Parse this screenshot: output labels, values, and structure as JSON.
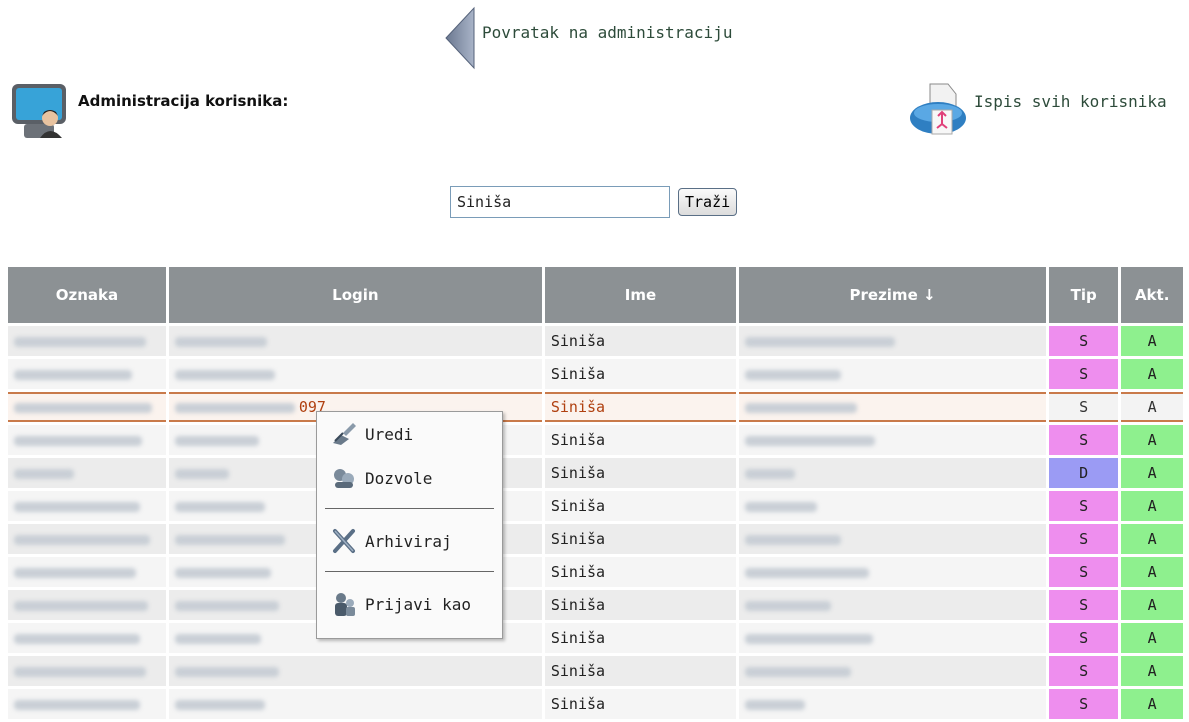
{
  "nav": {
    "back_label": "Povratak na administraciju",
    "page_title": "Administracija korisnika:",
    "print_label": "Ispis svih korisnika"
  },
  "search": {
    "value": "Siniša",
    "button_label": "Traži"
  },
  "table": {
    "headers": {
      "oznaka": "Oznaka",
      "login": "Login",
      "ime": "Ime",
      "prezime": "Prezime ↓",
      "tip": "Tip",
      "akt": "Akt."
    },
    "rows": [
      {
        "login_suffix": "",
        "ime": "Siniša",
        "tip": "S",
        "akt": "A"
      },
      {
        "login_suffix": "",
        "ime": "Siniša",
        "tip": "S",
        "akt": "A"
      },
      {
        "login_suffix": "097",
        "ime": "Siniša",
        "tip": "S",
        "akt": "A"
      },
      {
        "login_suffix": "",
        "ime": "Siniša",
        "tip": "S",
        "akt": "A"
      },
      {
        "login_suffix": "",
        "ime": "Siniša",
        "tip": "D",
        "akt": "A"
      },
      {
        "login_suffix": "",
        "ime": "Siniša",
        "tip": "S",
        "akt": "A"
      },
      {
        "login_suffix": "",
        "ime": "Siniša",
        "tip": "S",
        "akt": "A"
      },
      {
        "login_suffix": "",
        "ime": "Siniša",
        "tip": "S",
        "akt": "A"
      },
      {
        "login_suffix": "",
        "ime": "Siniša",
        "tip": "S",
        "akt": "A"
      },
      {
        "login_suffix": "",
        "ime": "Siniša",
        "tip": "S",
        "akt": "A"
      },
      {
        "login_suffix": "",
        "ime": "Siniša",
        "tip": "S",
        "akt": "A"
      },
      {
        "login_suffix": "",
        "ime": "Siniša",
        "tip": "S",
        "akt": "A"
      }
    ]
  },
  "context_menu": {
    "edit": "Uredi",
    "permissions": "Dozvole",
    "archive": "Arhiviraj",
    "login_as": "Prijavi kao"
  },
  "colors": {
    "header_bg": "#8c9194",
    "tip_s": "#ee8eee",
    "tip_d": "#9b9bf4",
    "akt_a": "#8ef08e",
    "selected_text": "#b04010"
  }
}
